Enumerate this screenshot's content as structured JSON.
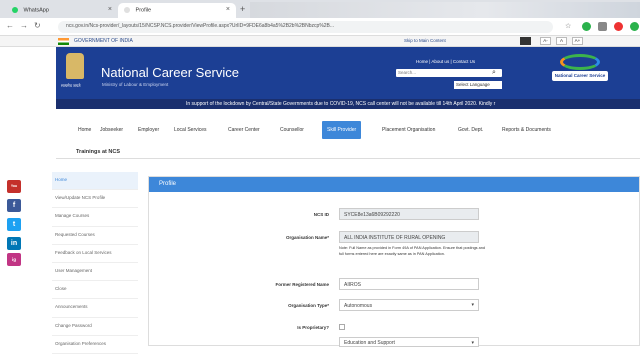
{
  "browser": {
    "tabs": [
      {
        "title": "WhatsApp"
      },
      {
        "title": "Profile"
      }
    ],
    "url": "ncs.gov.in/Ncs-provider/_layouts/15/NCSP.NCS.provider/ViewProfile.aspx?UrlID=9FDE6a8b4a5%2B2b%2BNbzcp%2B..."
  },
  "gov": {
    "label": "GOVERNMENT OF INDIA",
    "links": "Skip to Main Content",
    "font_buttons": [
      "A-",
      "A",
      "A+"
    ]
  },
  "header": {
    "title": "National Career Service",
    "subtitle": "Ministry of Labour & Employment",
    "emblem_caption": "सत्यमेव जयते",
    "links": "Home | About us | Contact Us",
    "search_placeholder": "Search...",
    "language": "Select Language",
    "logo_text": "National Career Service"
  },
  "ticker": "In support of the lockdown by Central/State Governments due to COVID-19, NCS call center will not be available till 14th April 2020. Kindly r",
  "menu": {
    "items": [
      "Home",
      "Jobseeker",
      "Employer",
      "Local Services",
      "Career Center",
      "Counsellor",
      "Skill Provider",
      "Placement Organisation",
      "Govt. Dept.",
      "Reports & Documents"
    ],
    "active": "Skill Provider",
    "row2": "Trainings at NCS"
  },
  "sidebar": {
    "items": [
      "Home",
      "View/Update NCS Profile",
      "Manage Courses",
      "Requested Courses",
      "Feedback on Local Services",
      "User Management",
      "Close",
      "Announcements",
      "Change Password",
      "Organisation Preferences"
    ]
  },
  "panel": {
    "title": "Profile",
    "fields": {
      "ncs_id": {
        "label": "NCS ID",
        "value": "SYCE8e13a6B09292220"
      },
      "org_name": {
        "label": "Organisation Name*",
        "value": "ALL INDIA INSTITUTE OF RURAL OPENING"
      },
      "help_text": "Note: Full Name as provided in Form 49A of PAN Application. Ensure that postings and full forms entered here are exactly same as in PAN Application.",
      "former_name": {
        "label": "Former Registered Name",
        "value": "AIIROS"
      },
      "org_type": {
        "label": "Organisation Type*",
        "value": "Autonomous"
      },
      "proprietary": {
        "label": "Is Proprietary?"
      },
      "next_value": "Education and Support"
    }
  },
  "social": [
    "You Tube",
    "f",
    "t",
    "in",
    "ig"
  ]
}
